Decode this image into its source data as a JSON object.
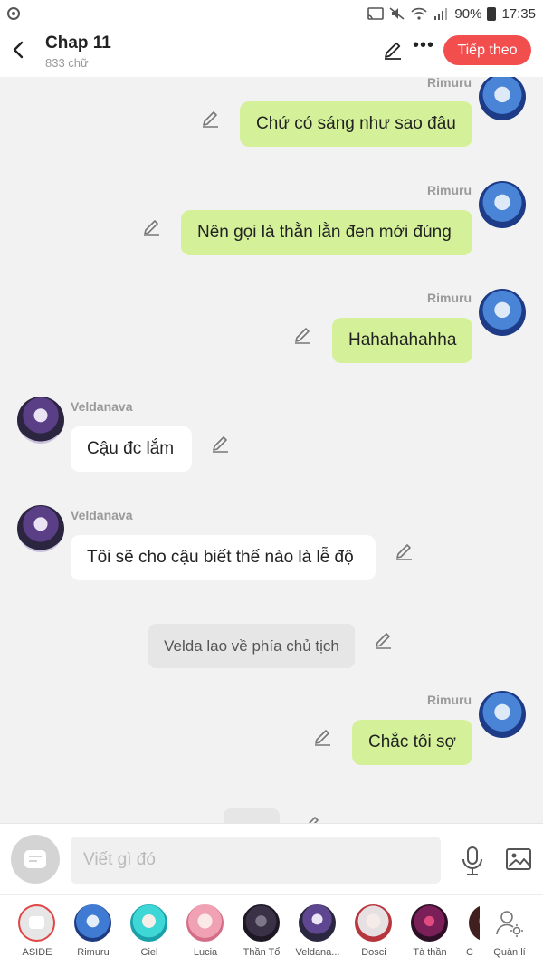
{
  "status_bar": {
    "battery": "90%",
    "time": "17:35"
  },
  "header": {
    "title": "Chap 11",
    "subtitle": "833 chữ",
    "next_label": "Tiếp theo"
  },
  "messages": [
    {
      "speaker": "Rimuru",
      "text": "Chứ có sáng như sao đâu"
    },
    {
      "speaker": "Rimuru",
      "text": "Nên gọi là thằn lằn đen mới đúng"
    },
    {
      "speaker": "Rimuru",
      "text": "Hahahahahha"
    },
    {
      "speaker": "Veldanava",
      "text": "Cậu đc lắm"
    },
    {
      "speaker": "Veldanava",
      "text": "Tôi sẽ cho cậu biết thế nào là lễ độ"
    },
    {
      "speaker": "",
      "text": "Velda lao về phía chủ tịch"
    },
    {
      "speaker": "Rimuru",
      "text": "Chắc tôi sợ"
    }
  ],
  "input": {
    "placeholder": "Viết gì đó"
  },
  "characters": [
    {
      "name": "ASIDE"
    },
    {
      "name": "Rimuru"
    },
    {
      "name": "Ciel"
    },
    {
      "name": "Lucia"
    },
    {
      "name": "Thần Tổ"
    },
    {
      "name": "Veldana..."
    },
    {
      "name": "Dosci"
    },
    {
      "name": "Tà thần"
    },
    {
      "name": "C"
    },
    {
      "name": "Quản lí"
    }
  ],
  "colors": {
    "accent": "#f24e4e",
    "right_bubble": "#d4f199",
    "left_bubble": "#ffffff",
    "narration_bubble": "#e6e6e6"
  }
}
